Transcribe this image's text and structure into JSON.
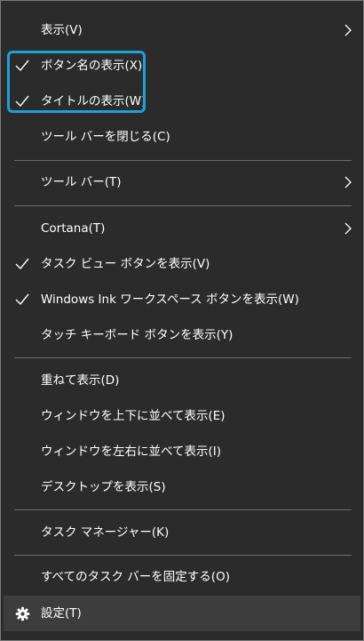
{
  "menu": {
    "items": [
      {
        "label": "表示(V)",
        "check": false,
        "submenu": true
      },
      {
        "label": "ボタン名の表示(X)",
        "check": true,
        "submenu": false
      },
      {
        "label": "タイトルの表示(W)",
        "check": true,
        "submenu": false
      },
      {
        "label": "ツール バーを閉じる(C)",
        "check": false,
        "submenu": false
      },
      {
        "label": "ツール バー(T)",
        "check": false,
        "submenu": true
      },
      {
        "label": "Cortana(T)",
        "check": false,
        "submenu": true
      },
      {
        "label": "タスク ビュー ボタンを表示(V)",
        "check": true,
        "submenu": false
      },
      {
        "label": "Windows Ink ワークスペース ボタンを表示(W)",
        "check": true,
        "submenu": false
      },
      {
        "label": "タッチ キーボード ボタンを表示(Y)",
        "check": false,
        "submenu": false
      },
      {
        "label": "重ねて表示(D)",
        "check": false,
        "submenu": false
      },
      {
        "label": "ウィンドウを上下に並べて表示(E)",
        "check": false,
        "submenu": false
      },
      {
        "label": "ウィンドウを左右に並べて表示(I)",
        "check": false,
        "submenu": false
      },
      {
        "label": "デスクトップを表示(S)",
        "check": false,
        "submenu": false
      },
      {
        "label": "タスク マネージャー(K)",
        "check": false,
        "submenu": false
      },
      {
        "label": "すべてのタスク バーを固定する(O)",
        "check": false,
        "submenu": false
      },
      {
        "label": "設定(T)",
        "icon": "gear-icon",
        "check": false,
        "submenu": false
      }
    ]
  },
  "colors": {
    "background": "#2b2b2b",
    "text": "#ffffff",
    "separator": "#6c6c6c",
    "highlight_outline": "#1ea0d9",
    "hovered_item": "#3d3d3d"
  }
}
